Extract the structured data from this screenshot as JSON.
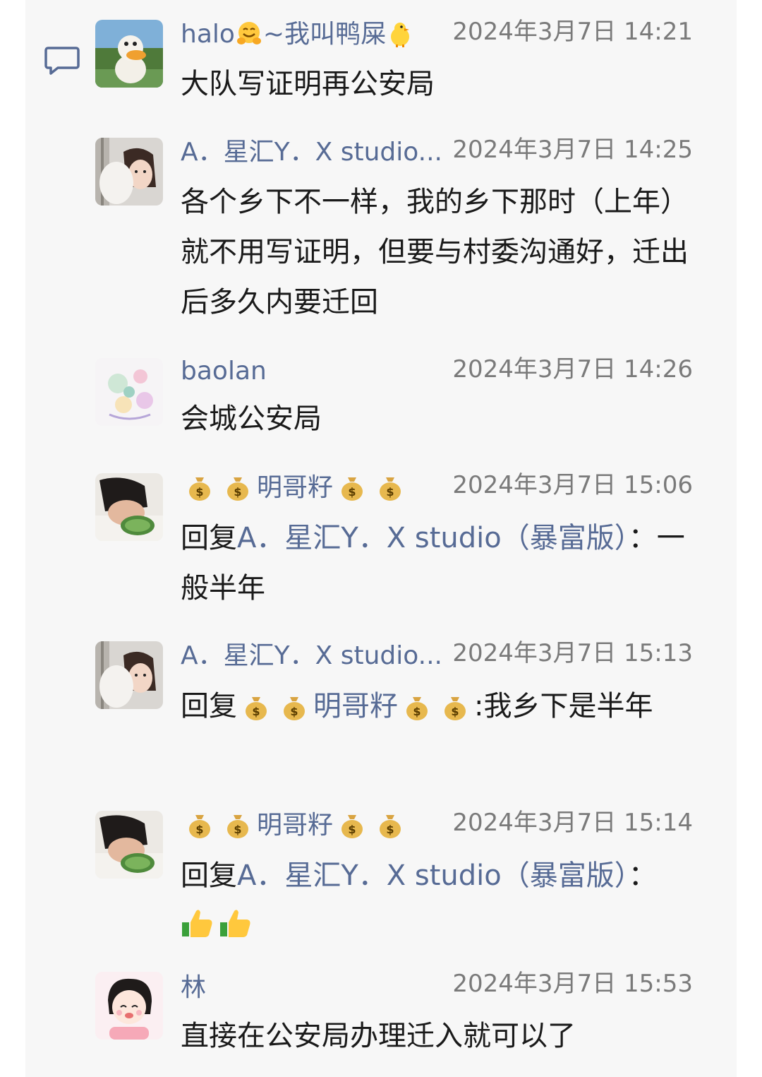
{
  "messages": [
    {
      "author_prefix": "halo",
      "author_middle": "~我叫鸭屎",
      "time": "2024年3月7日 14:21",
      "text": "大队写证明再公安局"
    },
    {
      "author": "A．星汇Y．X studio...",
      "time": "2024年3月7日 14:25",
      "text": "各个乡下不一样，我的乡下那时（上年）就不用写证明，但要与村委沟通好，迁出后多久内要迁回"
    },
    {
      "author": "baolan",
      "time": "2024年3月7日 14:26",
      "text": "会城公安局"
    },
    {
      "author": "明哥籽",
      "time": "2024年3月7日 15:06",
      "reply_prefix": "回复",
      "reply_to": "A．星汇Y．X studio（暴富版）",
      "reply_colon": "：",
      "text": "一般半年"
    },
    {
      "author": "A．星汇Y．X studio...",
      "time": "2024年3月7日 15:13",
      "reply_prefix": "回复",
      "reply_to": "明哥籽",
      "reply_colon": ":",
      "text": "我乡下是半年"
    },
    {
      "author": "明哥籽",
      "time": "2024年3月7日 15:14",
      "reply_prefix": "回复",
      "reply_to": "A．星汇Y．X studio（暴富版）",
      "reply_colon": "：",
      "text": ""
    },
    {
      "author": "林",
      "time": "2024年3月7日 15:53",
      "text": "直接在公安局办理迁入就可以了"
    }
  ],
  "icons": {
    "comment": "comment-icon",
    "money_bag": "money-bag-emoji",
    "thumbs_up": "thumbs-up-emoji",
    "hugging_face": "hugging-face-emoji",
    "chick": "baby-chick-emoji"
  },
  "colors": {
    "name": "#576b95",
    "time": "#7a7a7a",
    "text": "#1a1a1a",
    "panel": "#f7f7f7"
  }
}
